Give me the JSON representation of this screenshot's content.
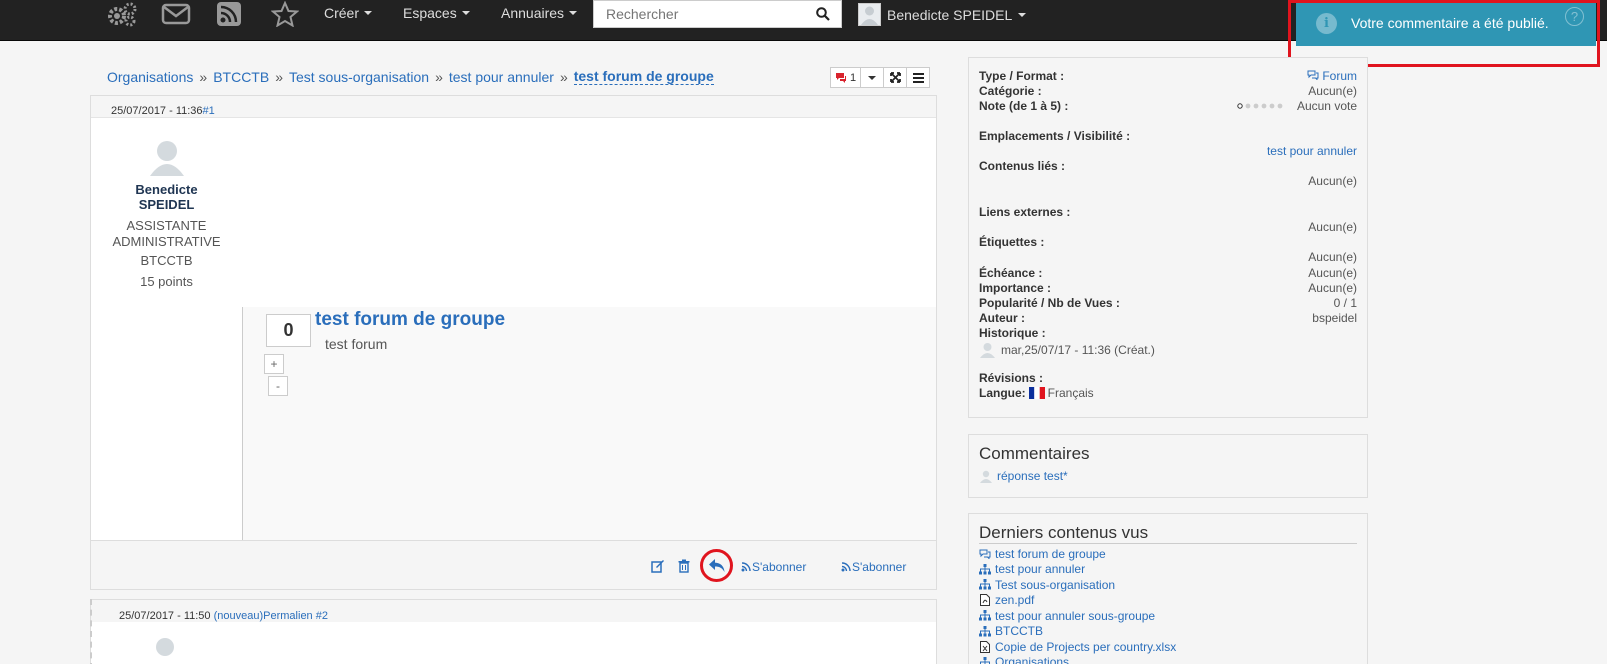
{
  "navbar": {
    "icons": [
      "gears-icon",
      "envelope-icon",
      "rss-icon",
      "star-icon"
    ],
    "menus": [
      "Créer",
      "Espaces",
      "Annuaires"
    ],
    "search_placeholder": "Rechercher",
    "user_name": "Benedicte SPEIDEL"
  },
  "notification": {
    "message": "Votre commentaire a été publié.",
    "help": "?"
  },
  "breadcrumb": {
    "items": [
      "Organisations",
      "BTCCTB",
      "Test sous-organisation",
      "test pour annuler"
    ],
    "separator": "»",
    "current": "test forum de groupe"
  },
  "tools": {
    "comment_count": "1"
  },
  "post": {
    "date": "25/07/2017 - 11:36",
    "permalink": "#1",
    "author": {
      "name": "Benedicte SPEIDEL",
      "role": "ASSISTANTE ADMINISTRATIVE",
      "org": "BTCCTB",
      "points": "15 points"
    },
    "votes": "0",
    "vote_plus": "+",
    "vote_minus": "-",
    "title": "test forum de groupe",
    "text": "test forum",
    "subscribe_1": "S'abonner",
    "subscribe_2": "S'abonner"
  },
  "post2": {
    "date": "25/07/2017 - 11:50",
    "new_tag": "(nouveau)",
    "permalink": "Permalien #2"
  },
  "info": {
    "type_label": "Type / Format :",
    "type_value": "Forum",
    "category_label": "Catégorie :",
    "category_value": "Aucun(e)",
    "rating_label": "Note (de 1 à 5) :",
    "rating_value": "Aucun vote",
    "locations_label": "Emplacements / Visibilité :",
    "locations_value": "test pour annuler",
    "related_label": "Contenus liés :",
    "related_value": "Aucun(e)",
    "links_label": "Liens externes :",
    "links_value": "Aucun(e)",
    "tags_label": "Étiquettes :",
    "tags_value": "Aucun(e)",
    "due_label": "Échéance :",
    "due_value": "Aucun(e)",
    "importance_label": "Importance :",
    "importance_value": "Aucun(e)",
    "popularity_label": "Popularité / Nb de Vues :",
    "popularity_value": "0 / 1",
    "author_label": "Auteur :",
    "author_value": "bspeidel",
    "history_label": "Historique :",
    "history_value": "mar,25/07/17 - 11:36 (Créat.)",
    "revisions_label": "Révisions :",
    "language_label": "Langue:",
    "language_value": "Français"
  },
  "comments": {
    "title": "Commentaires",
    "items": [
      "réponse test*"
    ]
  },
  "recent": {
    "title": "Derniers contenus vus",
    "items": [
      {
        "label": "test forum de groupe",
        "icon": "forum-icon"
      },
      {
        "label": "test pour annuler",
        "icon": "sitemap-icon"
      },
      {
        "label": "Test sous-organisation",
        "icon": "sitemap-icon"
      },
      {
        "label": "zen.pdf",
        "icon": "pdf-file-icon"
      },
      {
        "label": "test pour annuler sous-groupe",
        "icon": "sitemap-icon"
      },
      {
        "label": "BTCCTB",
        "icon": "sitemap-icon"
      },
      {
        "label": "Copie de Projects per country.xlsx",
        "icon": "excel-file-icon"
      },
      {
        "label": "Organisations",
        "icon": "sitemap-icon"
      }
    ]
  },
  "colors": {
    "navbar": "#222222",
    "link": "#2a6ebb",
    "notification": "#2f96b4",
    "highlight": "#e0141e"
  }
}
